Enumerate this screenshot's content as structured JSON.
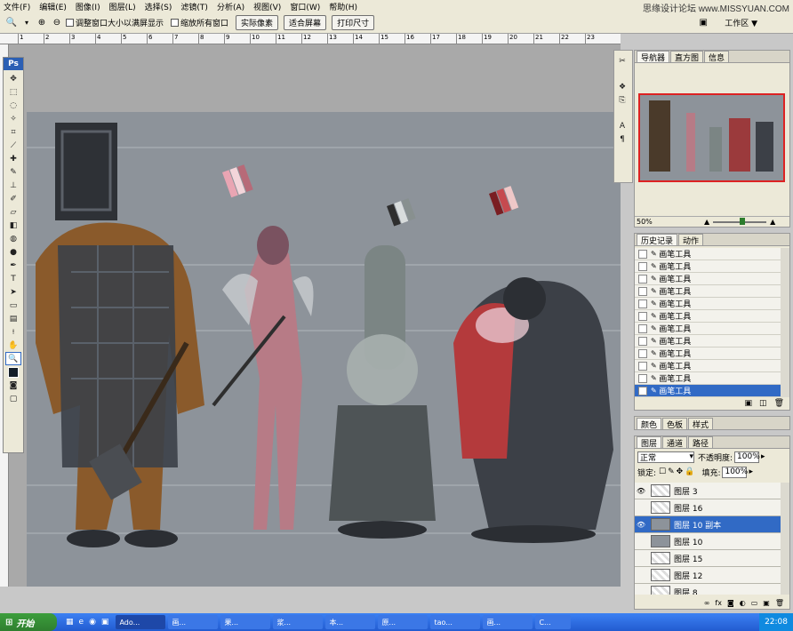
{
  "menubar": {
    "items": [
      "文件(F)",
      "编辑(E)",
      "图像(I)",
      "图层(L)",
      "选择(S)",
      "滤镜(T)",
      "分析(A)",
      "视图(V)",
      "窗口(W)",
      "帮助(H)"
    ],
    "brand": "思缘设计论坛 www.MISSYUAN.COM"
  },
  "options": {
    "chk1": "调整窗口大小以满屏显示",
    "chk2": "缩放所有窗口",
    "btn1": "实际像素",
    "btn2": "适合屏幕",
    "btn3": "打印尺寸",
    "workspace": "工作区 ▼"
  },
  "ruler": {
    "marks": [
      "1",
      "2",
      "3",
      "4",
      "5",
      "6",
      "7",
      "8",
      "9",
      "10",
      "11",
      "12",
      "13",
      "14",
      "15",
      "16",
      "17",
      "18",
      "19",
      "20",
      "21",
      "22",
      "23"
    ]
  },
  "toolbox": {
    "logo": "Ps"
  },
  "navigator": {
    "tabs": [
      "导航器",
      "直方图",
      "信息"
    ],
    "zoom": "50%"
  },
  "history": {
    "tabs": [
      "历史记录",
      "动作"
    ],
    "items": [
      "画笔工具",
      "画笔工具",
      "画笔工具",
      "画笔工具",
      "画笔工具",
      "画笔工具",
      "画笔工具",
      "画笔工具",
      "画笔工具",
      "画笔工具",
      "画笔工具",
      "画笔工具"
    ]
  },
  "color_tabs": [
    "颜色",
    "色板",
    "样式"
  ],
  "layers": {
    "tabs": [
      "图层",
      "通道",
      "路径"
    ],
    "blend": "正常",
    "opacity_label": "不透明度:",
    "opacity": "100%",
    "lock_label": "锁定:",
    "fill_label": "填充:",
    "fill": "100%",
    "items": [
      {
        "name": "图层 3",
        "visible": true,
        "selected": false
      },
      {
        "name": "图层 16",
        "visible": false,
        "selected": false
      },
      {
        "name": "图层 10 副本",
        "visible": true,
        "selected": true
      },
      {
        "name": "图层 10",
        "visible": false,
        "selected": false
      },
      {
        "name": "图层 15",
        "visible": false,
        "selected": false
      },
      {
        "name": "图层 12",
        "visible": false,
        "selected": false
      },
      {
        "name": "图层 8",
        "visible": false,
        "selected": false
      }
    ]
  },
  "taskbar": {
    "start": "开始",
    "buttons": [
      "Ado...",
      "画...",
      "果...",
      "浆...",
      "本...",
      "原...",
      "tao...",
      "画...",
      "C..."
    ],
    "clock": "22:08"
  },
  "colors": {
    "accent": "#316ac5",
    "panel": "#ece9d8",
    "canvas": "#8d939a"
  }
}
